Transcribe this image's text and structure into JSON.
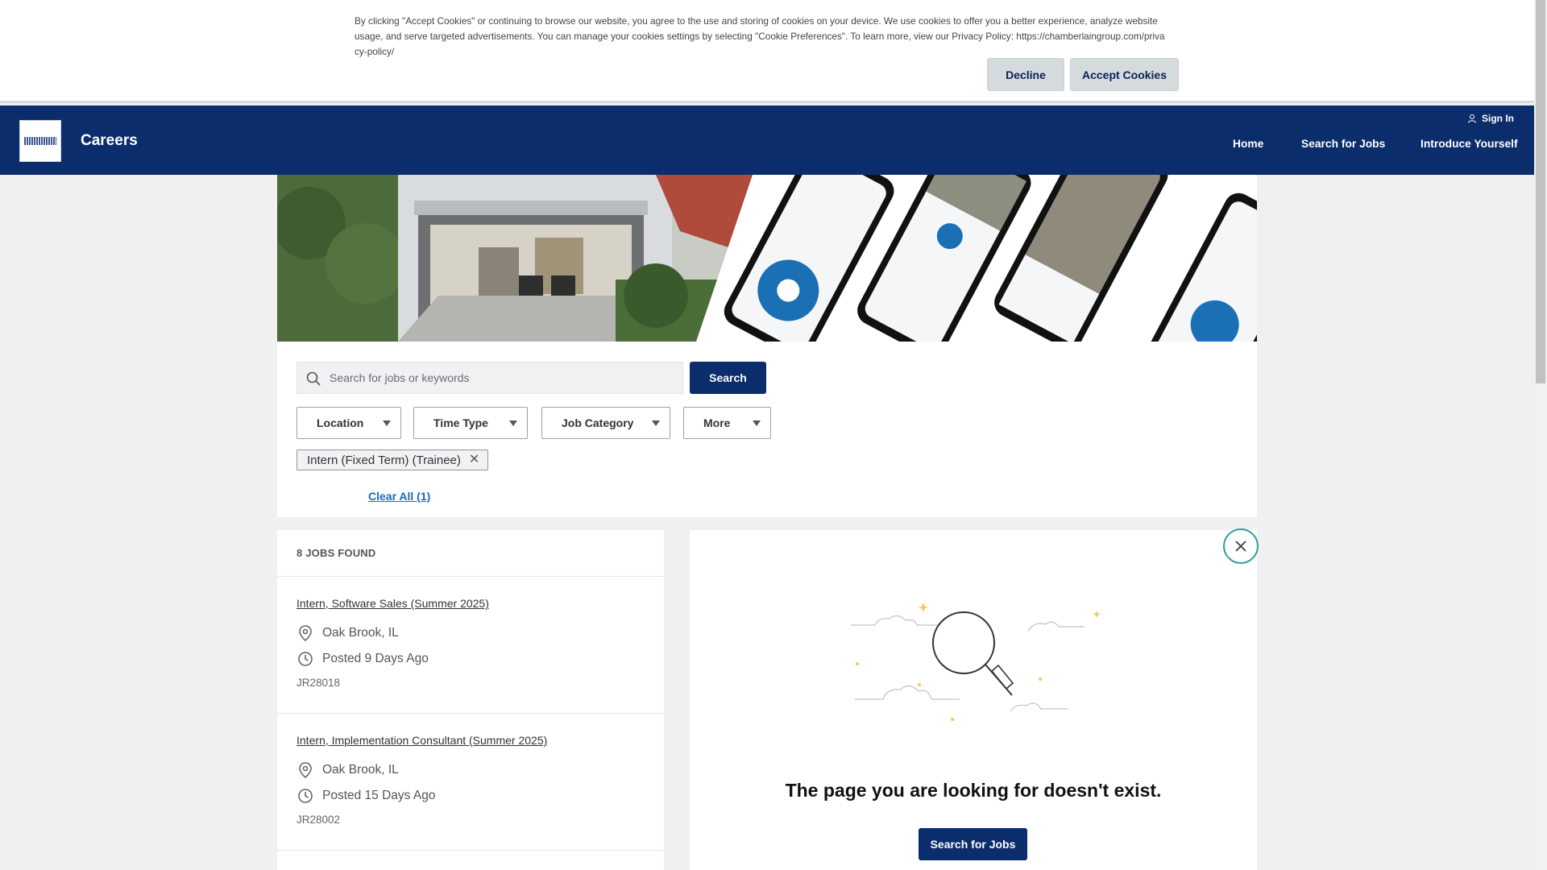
{
  "cookie_banner": {
    "text_line1": "By clicking \"Accept Cookies\" or continuing to browse our website, you agree to the use and storing of cookies on your device. We use cookies to offer you a better experience, analyze website",
    "text_line2": "usage, and serve targeted advertisements. You can manage your cookies settings by selecting \"Cookie Preferences\". To learn more, view our Privacy Policy: https://chamberlaingroup.com/priva",
    "text_line3": "cy-policy/",
    "decline_label": "Decline",
    "accept_label": "Accept Cookies"
  },
  "header": {
    "brand": "Careers",
    "sign_in": "Sign In",
    "nav": [
      "Home",
      "Search for Jobs",
      "Introduce Yourself"
    ]
  },
  "search": {
    "placeholder": "Search for jobs or keywords",
    "button_label": "Search"
  },
  "filters": [
    "Location",
    "Time Type",
    "Job Category",
    "More"
  ],
  "active_filter": "Intern (Fixed Term) (Trainee)",
  "clear_all": "Clear All (1)",
  "jobs_found": "8 JOBS FOUND",
  "jobs": [
    {
      "title": "Intern, Software Sales (Summer 2025)",
      "location": "Oak Brook, IL",
      "posted": "Posted 9 Days Ago",
      "id": "JR28018"
    },
    {
      "title": "Intern, Implementation Consultant (Summer 2025)",
      "location": "Oak Brook, IL",
      "posted": "Posted 15 Days Ago",
      "id": "JR28002"
    }
  ],
  "not_found": {
    "title": "The page you are looking for doesn't exist.",
    "button_label": "Search for Jobs"
  },
  "colors": {
    "navy": "#0b2d6b",
    "link_blue": "#1569c7",
    "teal": "#2b9da0",
    "star": "#f2c94c"
  }
}
